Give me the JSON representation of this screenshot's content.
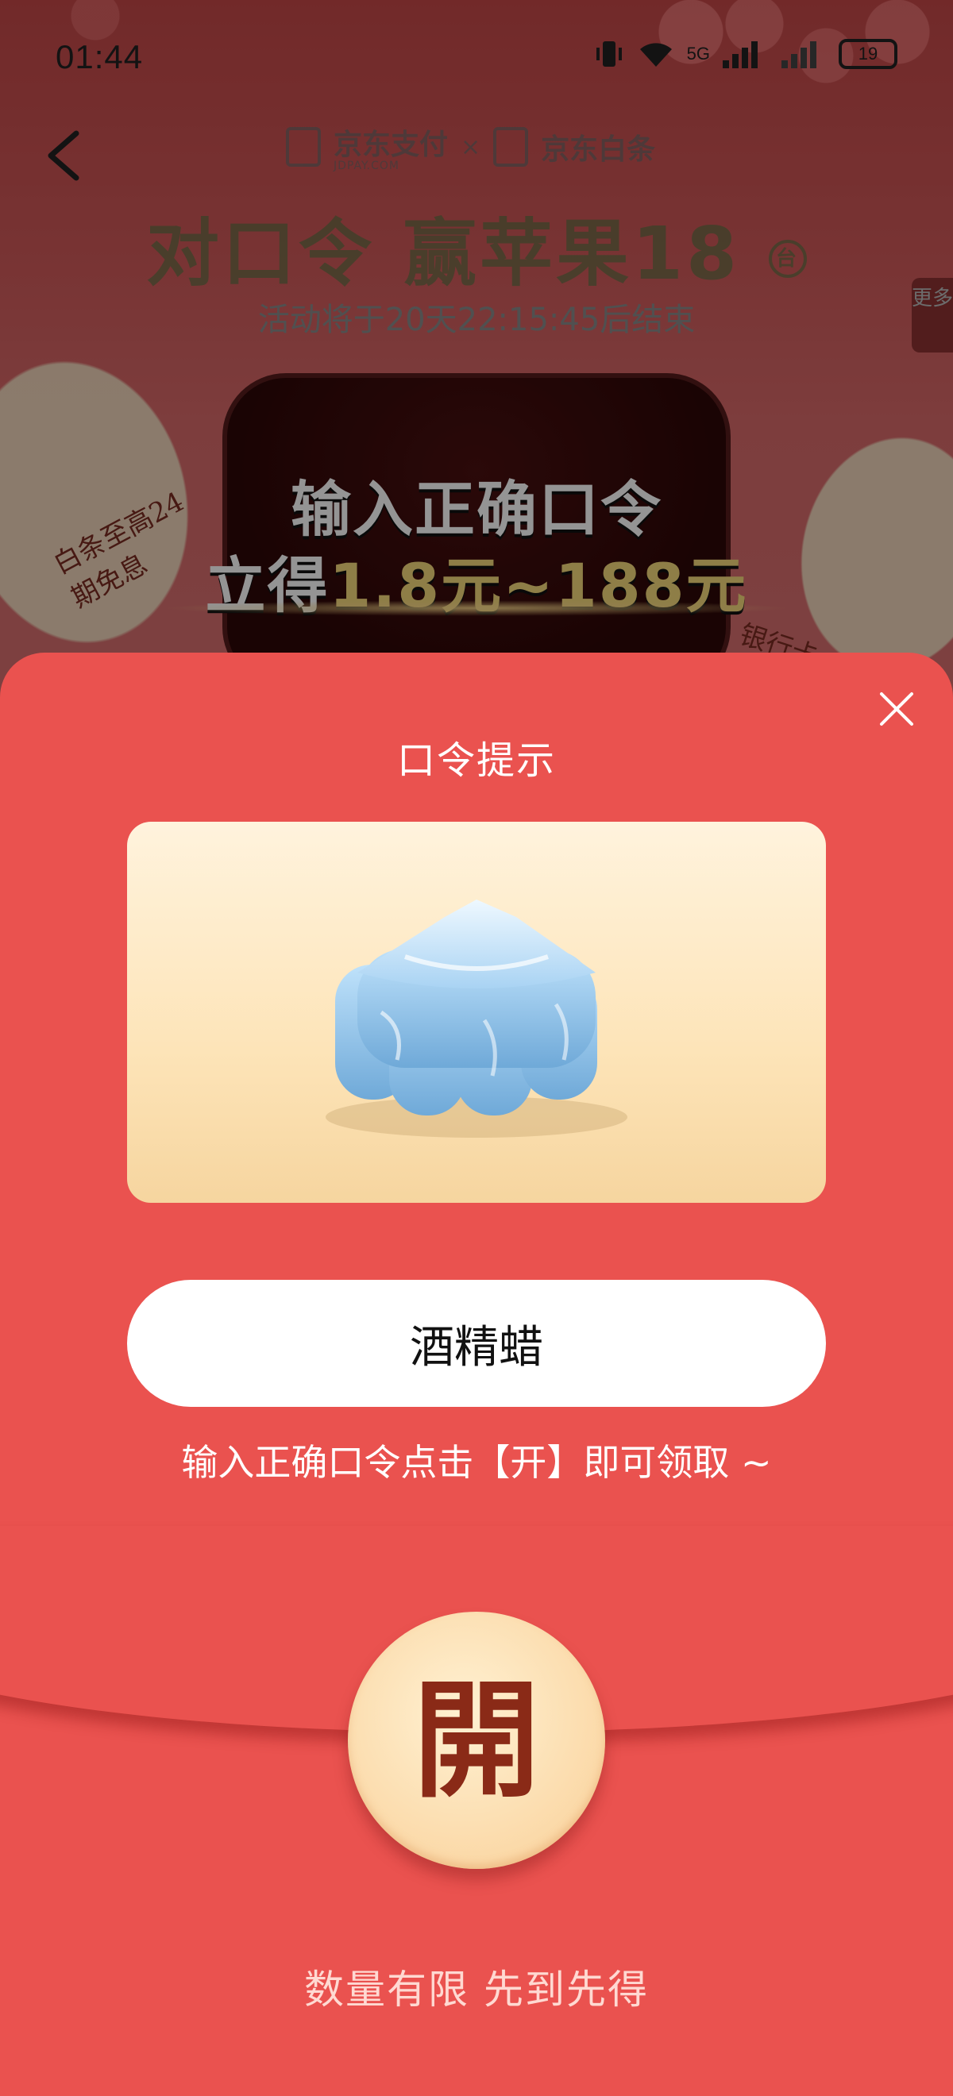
{
  "status_bar": {
    "time": "01:44",
    "network_label": "5G",
    "battery_level": "19"
  },
  "background_page": {
    "brand_left_name": "京东支付",
    "brand_left_sub": "JDPAY.COM",
    "brand_separator": "×",
    "brand_right_name": "京东白条",
    "headline": "对口令 赢苹果18",
    "headline_badge": "台",
    "countdown": "活动将于20天22:15:45后结束",
    "more_tab": "更多",
    "promo_line1": "输入正确口令",
    "promo_line2_prefix": "立得",
    "promo_line2_amount": "1.8元~188元",
    "handwrite_left": "白条至高24期免息",
    "handwrite_right": "银行卡"
  },
  "modal": {
    "title": "口令提示",
    "hint_image": "blue-wax-candle-illustration",
    "answer_value": "酒精蜡",
    "instruction": "输入正确口令点击【开】即可领取 ~",
    "open_button_label": "開",
    "footer_note": "数量有限 先到先得"
  },
  "colors": {
    "sheet_red": "#ea524f",
    "open_glyph": "#8a2a17",
    "card_cream": "#fde4b8",
    "promo_gold": "#f5d97b"
  }
}
